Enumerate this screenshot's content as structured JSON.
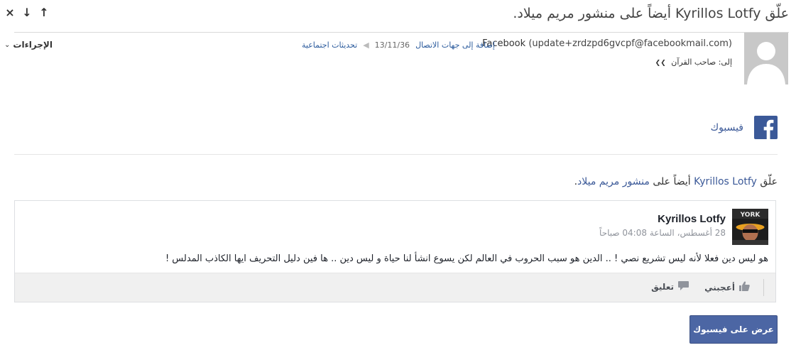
{
  "email": {
    "subject": "علّق Kyrillos Lotfy أيضاً على منشور مريم ميلاد.",
    "sender_name": "Facebook",
    "sender_email": "(update+zrdzpd6gvcpf@facebookmail.com)",
    "add_contact_label": "إضافة إلى جهات الاتصال",
    "date": "13/11/36",
    "category_label": "تحديثات اجتماعية",
    "to_label": "إلى: صاحب القرآن",
    "actions_label": "الإجراءات"
  },
  "nav": {
    "close_icon": "×",
    "down_icon": "↓",
    "up_icon": "↑"
  },
  "body": {
    "brand_name": "فيسبوك",
    "notification_author": "Kyrillos Lotfy",
    "notification_mid": " أيضاً على ",
    "notification_post": "منشور مريم ميلاد",
    "notification_tail": "."
  },
  "card": {
    "author": "Kyrillos Lotfy",
    "date": "28 أغسطس، الساعة 04:08 صباحاً",
    "text": "هو ليس دين فعلا لأنه ليس تشريع نصي ! .. الدين هو سبب الحروب في العالم لكن يسوع انشأ لنا حياة و ليس دين .. ها فين دليل التحريف ايها الكاذب المدلس !",
    "like_label": "أعجبني",
    "comment_label": "تعليق"
  },
  "footer": {
    "view_button_label": "عرض على فيسبوك"
  },
  "colors": {
    "facebook_blue": "#3b5998",
    "button_blue": "#4c66a4",
    "link_blue": "#2a5a9c"
  }
}
